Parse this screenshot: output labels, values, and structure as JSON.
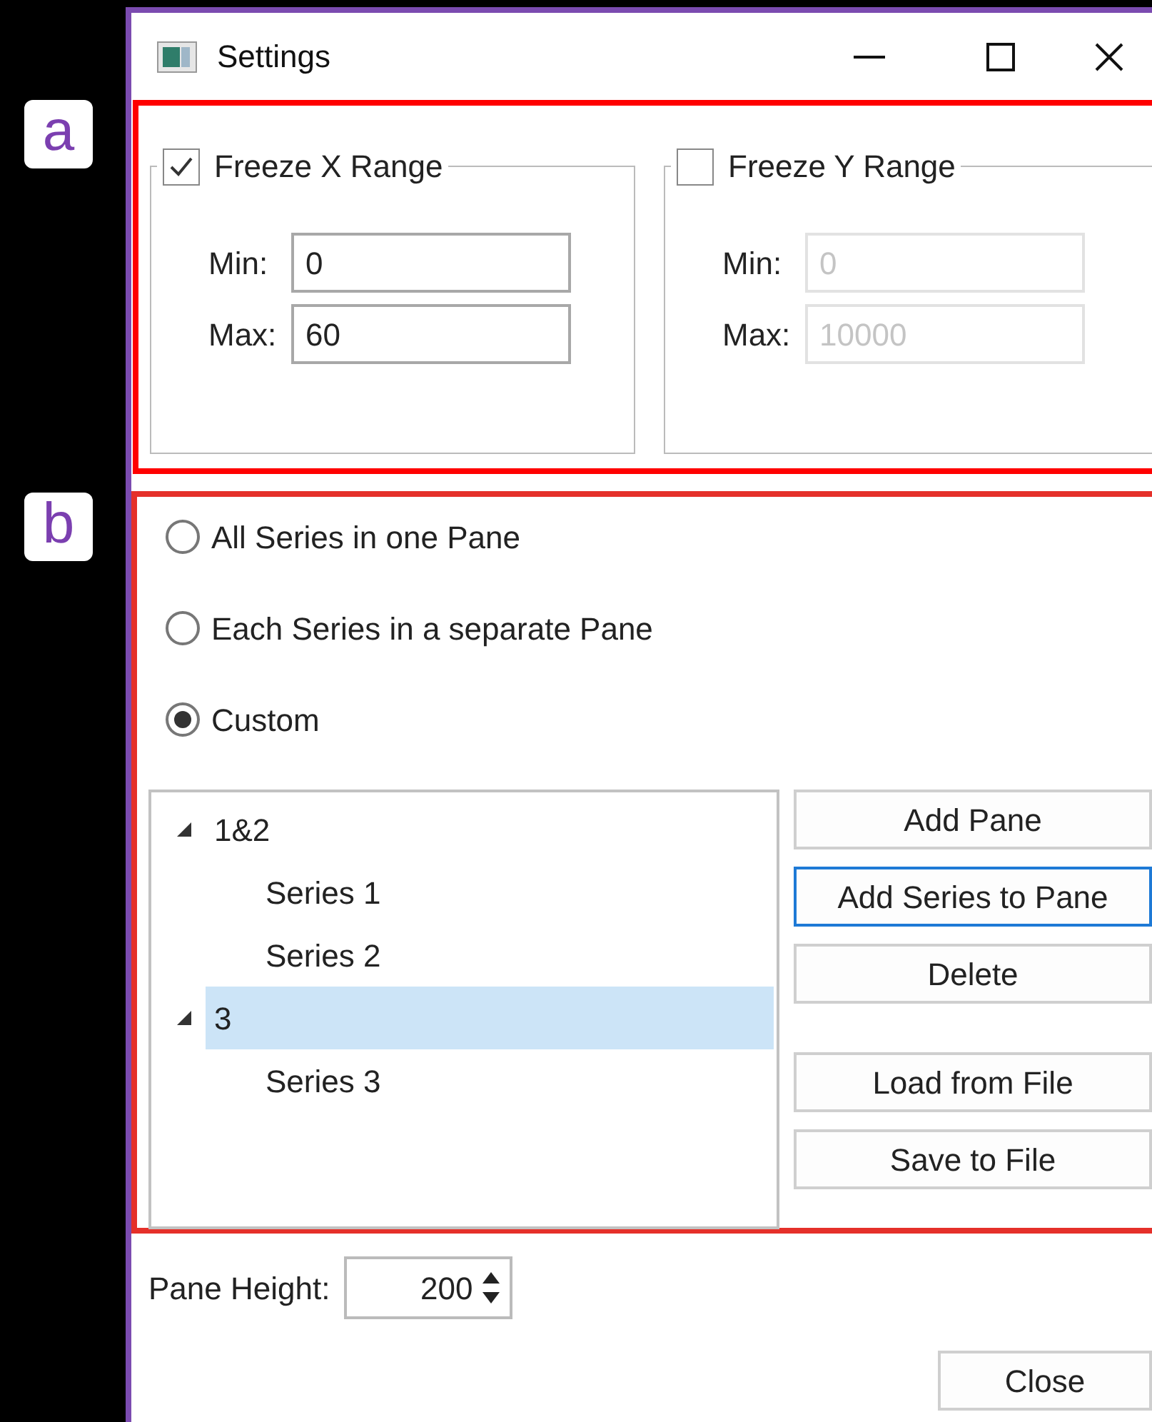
{
  "annotations": [
    {
      "label": "a"
    },
    {
      "label": "b"
    }
  ],
  "window": {
    "title": "Settings"
  },
  "range_groups": [
    {
      "label": "Freeze X Range",
      "checked": true,
      "fields": [
        {
          "label": "Min:",
          "value": "0",
          "disabled": false
        },
        {
          "label": "Max:",
          "value": "60",
          "disabled": false
        }
      ]
    },
    {
      "label": "Freeze Y Range",
      "checked": false,
      "fields": [
        {
          "label": "Min:",
          "value": "0",
          "disabled": true
        },
        {
          "label": "Max:",
          "value": "10000",
          "disabled": true
        }
      ]
    }
  ],
  "layout_options": [
    {
      "label": "All Series in one Pane",
      "selected": false
    },
    {
      "label": "Each Series in a separate Pane",
      "selected": false
    },
    {
      "label": "Custom",
      "selected": true
    }
  ],
  "tree": [
    {
      "label": "1&2",
      "expanded": true,
      "selected": false,
      "children": [
        {
          "label": "Series 1",
          "selected": false
        },
        {
          "label": "Series 2",
          "selected": false
        }
      ]
    },
    {
      "label": "3",
      "expanded": true,
      "selected": true,
      "children": [
        {
          "label": "Series 3",
          "selected": false
        }
      ]
    }
  ],
  "pane_buttons": [
    {
      "label": "Add Pane",
      "focused": false
    },
    {
      "label": "Add Series to Pane",
      "focused": true
    },
    {
      "label": "Delete",
      "focused": false
    },
    {
      "label": "Load from File",
      "focused": false
    },
    {
      "label": "Save to File",
      "focused": false
    }
  ],
  "pane_height": {
    "label": "Pane Height:",
    "value": "200"
  },
  "close_button": {
    "label": "Close"
  }
}
